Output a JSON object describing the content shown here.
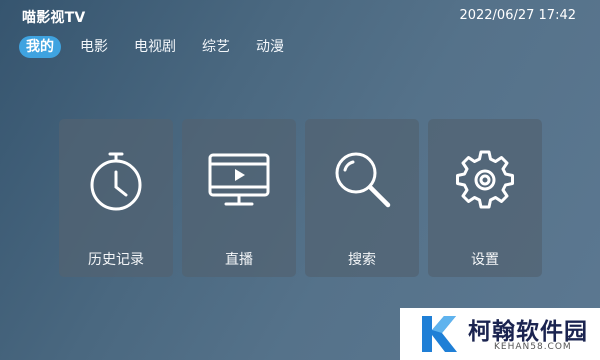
{
  "header": {
    "app_title": "喵影视TV",
    "datetime": "2022/06/27 17:42"
  },
  "tabs": [
    {
      "label": "我的",
      "active": true
    },
    {
      "label": "电影",
      "active": false
    },
    {
      "label": "电视剧",
      "active": false
    },
    {
      "label": "综艺",
      "active": false
    },
    {
      "label": "动漫",
      "active": false
    }
  ],
  "cards": [
    {
      "label": "历史记录",
      "icon": "stopwatch-icon"
    },
    {
      "label": "直播",
      "icon": "tv-play-icon"
    },
    {
      "label": "搜索",
      "icon": "magnifier-icon"
    },
    {
      "label": "设置",
      "icon": "gear-icon"
    }
  ],
  "watermark": {
    "text": "柯翰软件园",
    "url": "KEHAN58.COM"
  },
  "colors": {
    "accent": "#3fa3e0",
    "card_bg": "#526272",
    "watermark_brand": "#1b2450"
  }
}
